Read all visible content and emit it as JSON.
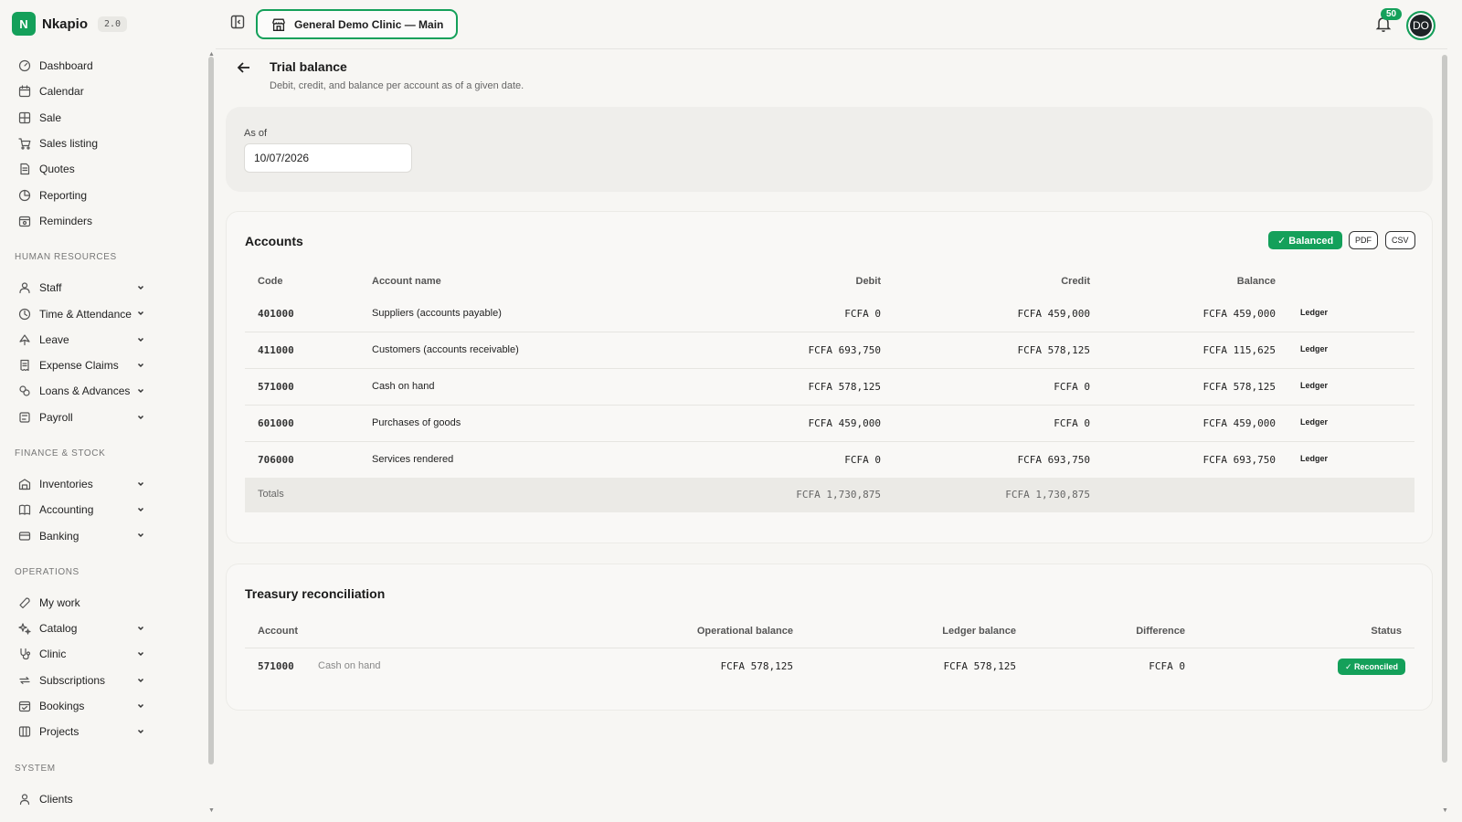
{
  "app": {
    "name": "Nkapio",
    "version": "2.0"
  },
  "sidebar": {
    "top_items": [
      {
        "label": "Dashboard",
        "icon": "gauge-icon"
      },
      {
        "label": "Calendar",
        "icon": "calendar-icon"
      },
      {
        "label": "Sale",
        "icon": "grid-icon"
      },
      {
        "label": "Sales listing",
        "icon": "cart-icon"
      },
      {
        "label": "Quotes",
        "icon": "document-icon"
      },
      {
        "label": "Reporting",
        "icon": "pie-icon"
      },
      {
        "label": "Reminders",
        "icon": "bell-calendar-icon"
      }
    ],
    "sections": [
      {
        "title": "HUMAN RESOURCES",
        "items": [
          {
            "label": "Staff",
            "icon": "users-icon"
          },
          {
            "label": "Time & Attendance",
            "icon": "clock-icon"
          },
          {
            "label": "Leave",
            "icon": "plane-icon"
          },
          {
            "label": "Expense Claims",
            "icon": "receipt-icon"
          },
          {
            "label": "Loans & Advances",
            "icon": "coins-icon"
          },
          {
            "label": "Payroll",
            "icon": "payroll-icon"
          }
        ]
      },
      {
        "title": "FINANCE & STOCK",
        "items": [
          {
            "label": "Inventories",
            "icon": "warehouse-icon"
          },
          {
            "label": "Accounting",
            "icon": "book-icon"
          },
          {
            "label": "Banking",
            "icon": "bank-card-icon"
          }
        ]
      },
      {
        "title": "OPERATIONS",
        "items": [
          {
            "label": "My work",
            "icon": "wrench-icon"
          },
          {
            "label": "Catalog",
            "icon": "sparkles-icon"
          },
          {
            "label": "Clinic",
            "icon": "stethoscope-icon"
          },
          {
            "label": "Subscriptions",
            "icon": "repeat-icon"
          },
          {
            "label": "Bookings",
            "icon": "calendar-check-icon"
          },
          {
            "label": "Projects",
            "icon": "columns-icon"
          }
        ]
      },
      {
        "title": "SYSTEM",
        "items": [
          {
            "label": "Clients",
            "icon": "user-icon"
          }
        ]
      }
    ]
  },
  "header": {
    "clinic": "General Demo Clinic — Main",
    "notifications": "50",
    "avatar": "DO"
  },
  "page": {
    "title": "Trial balance",
    "subtitle": "Debit, credit, and balance per account as of a given date."
  },
  "filter": {
    "label": "As of",
    "date": "10/07/2026"
  },
  "accounts": {
    "title": "Accounts",
    "status": "✓ Balanced",
    "pdf": "PDF",
    "csv": "CSV",
    "columns": {
      "code": "Code",
      "name": "Account name",
      "debit": "Debit",
      "credit": "Credit",
      "balance": "Balance"
    },
    "rows": [
      {
        "code": "401000",
        "name": "Suppliers (accounts payable)",
        "debit": "FCFA 0",
        "credit": "FCFA 459,000",
        "balance": "FCFA 459,000",
        "action": "Ledger"
      },
      {
        "code": "411000",
        "name": "Customers (accounts receivable)",
        "debit": "FCFA 693,750",
        "credit": "FCFA 578,125",
        "balance": "FCFA 115,625",
        "action": "Ledger"
      },
      {
        "code": "571000",
        "name": "Cash on hand",
        "debit": "FCFA 578,125",
        "credit": "FCFA 0",
        "balance": "FCFA 578,125",
        "action": "Ledger"
      },
      {
        "code": "601000",
        "name": "Purchases of goods",
        "debit": "FCFA 459,000",
        "credit": "FCFA 0",
        "balance": "FCFA 459,000",
        "action": "Ledger"
      },
      {
        "code": "706000",
        "name": "Services rendered",
        "debit": "FCFA 0",
        "credit": "FCFA 693,750",
        "balance": "FCFA 693,750",
        "action": "Ledger"
      }
    ],
    "totals": {
      "label": "Totals",
      "debit": "FCFA 1,730,875",
      "credit": "FCFA 1,730,875"
    }
  },
  "treasury": {
    "title": "Treasury reconciliation",
    "columns": {
      "account": "Account",
      "operational": "Operational balance",
      "ledger": "Ledger balance",
      "difference": "Difference",
      "status": "Status"
    },
    "rows": [
      {
        "code": "571000",
        "name": "Cash on hand",
        "operational": "FCFA 578,125",
        "ledger": "FCFA 578,125",
        "difference": "FCFA 0",
        "status": "✓ Reconciled"
      }
    ]
  },
  "colors": {
    "accent": "#14a05a",
    "background": "#f7f6f3"
  }
}
